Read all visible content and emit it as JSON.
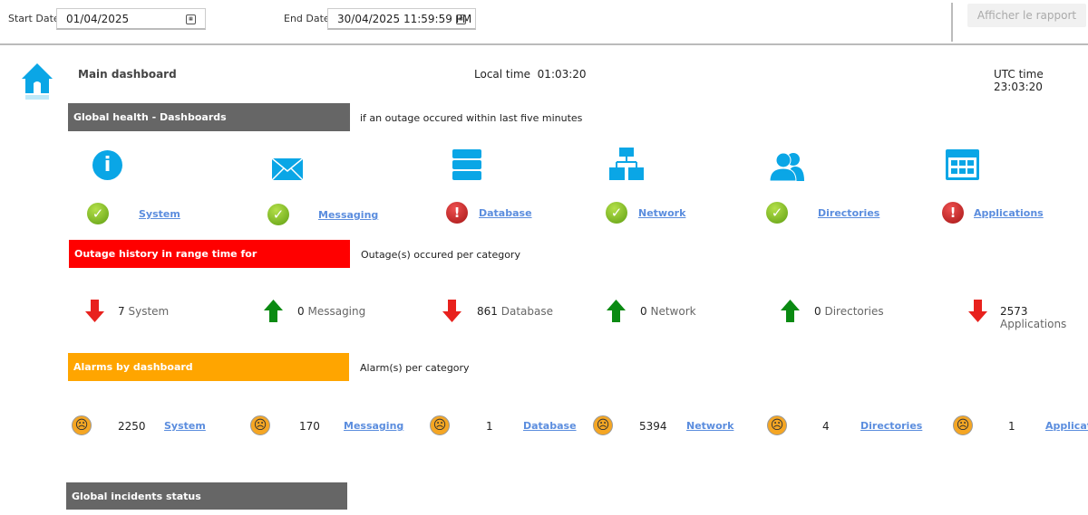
{
  "toolbar": {
    "start_label": "Start Date",
    "start_value": "01/04/2025",
    "end_label": "End Date",
    "end_value": "30/04/2025 11:59:59 PM",
    "report_button": "Afficher le rapport"
  },
  "header": {
    "title": "Main dashboard",
    "local_time_label": "Local time",
    "local_time": "01:03:20",
    "utc_time_label": "UTC time",
    "utc_time": "23:03:20"
  },
  "health": {
    "title": "Global health - Dashboards",
    "note": "if an outage occured within last five minutes",
    "items": [
      {
        "label": "System",
        "status": "ok",
        "icon": "info-icon"
      },
      {
        "label": "Messaging",
        "status": "ok",
        "icon": "envelope-icon"
      },
      {
        "label": "Database",
        "status": "error",
        "icon": "database-icon"
      },
      {
        "label": "Network",
        "status": "ok",
        "icon": "network-icon"
      },
      {
        "label": "Directories",
        "status": "ok",
        "icon": "users-icon"
      },
      {
        "label": "Applications",
        "status": "error",
        "icon": "applications-icon"
      }
    ]
  },
  "outages": {
    "title": "Outage history in range time for",
    "note": "Outage(s) occured per category",
    "items": [
      {
        "count": "7",
        "label": "System",
        "trend": "down"
      },
      {
        "count": "0",
        "label": "Messaging",
        "trend": "up"
      },
      {
        "count": "861",
        "label": "Database",
        "trend": "down"
      },
      {
        "count": "0",
        "label": "Network",
        "trend": "up"
      },
      {
        "count": "0",
        "label": "Directories",
        "trend": "up"
      },
      {
        "count": "2573",
        "label": "Applications",
        "trend": "down"
      }
    ]
  },
  "alarms": {
    "title": "Alarms by dashboard",
    "note": "Alarm(s) per category",
    "items": [
      {
        "count": "2250",
        "label": "System"
      },
      {
        "count": "170",
        "label": "Messaging"
      },
      {
        "count": "1",
        "label": "Database"
      },
      {
        "count": "5394",
        "label": "Network"
      },
      {
        "count": "4",
        "label": "Directories"
      },
      {
        "count": "1",
        "label": "Applications"
      }
    ]
  },
  "incidents": {
    "title": "Global incidents status"
  },
  "colors": {
    "health_bar": "#666666",
    "outage_bar": "#ff0000",
    "alarm_bar": "#ffa500",
    "accent": "#0aa6e6",
    "link": "#5b8dde"
  }
}
